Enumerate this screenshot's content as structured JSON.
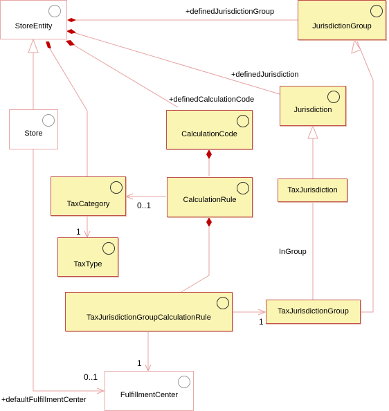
{
  "diagram": {
    "classes": {
      "store_entity": "StoreEntity",
      "jurisdiction_group": "JurisdictionGroup",
      "jurisdiction": "Jurisdiction",
      "store": "Store",
      "calculation_code": "CalculationCode",
      "tax_category": "TaxCategory",
      "calculation_rule": "CalculationRule",
      "tax_jurisdiction": "TaxJurisdiction",
      "tax_type": "TaxType",
      "tax_jurisdiction_group_calculation_rule": "TaxJurisdictionGroupCalculationRule",
      "tax_jurisdiction_group": "TaxJurisdictionGroup",
      "fulfillment_center": "FulfillmentCenter"
    },
    "roles": {
      "defined_jurisdiction_group": "+definedJurisdictionGroup",
      "defined_jurisdiction": "+definedJurisdiction",
      "defined_calculation_code": "+definedCalculationCode",
      "default_fulfillment_center": "+defaultFulfillmentCenter",
      "in_group": "InGroup"
    },
    "multiplicities": {
      "tax_category_from_rule": "0..1",
      "tax_type": "1",
      "tax_jurisdiction_group": "1",
      "fulfillment_center_from_rule": "1",
      "fulfillment_center_from_store": "0..1"
    },
    "colors": {
      "line": "#e8a0a0",
      "composition_diamond": "#c00000",
      "class_fill": "#fbf5b4",
      "class_border": "#c0504d"
    }
  }
}
